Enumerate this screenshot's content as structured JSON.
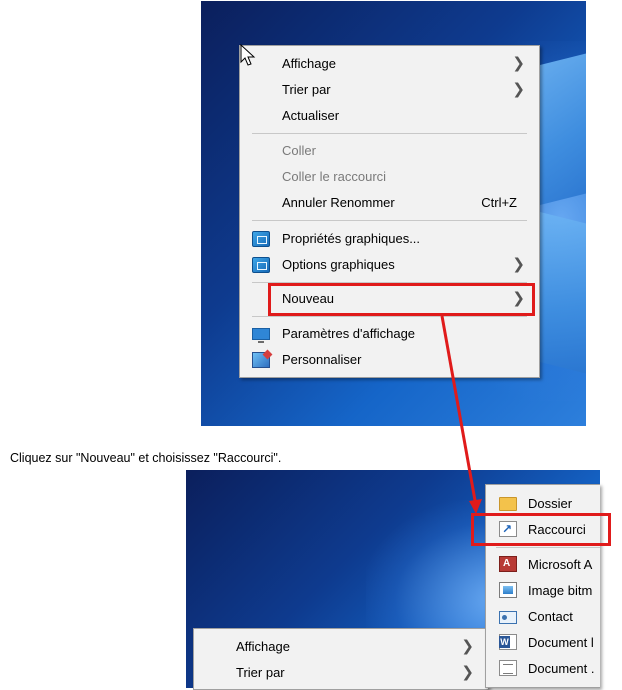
{
  "caption": "Cliquez sur \"Nouveau\" et choisissez \"Raccourci\".",
  "menu1": {
    "items": [
      {
        "label": "Affichage",
        "submenu": true
      },
      {
        "label": "Trier par",
        "submenu": true
      },
      {
        "label": "Actualiser"
      },
      {
        "label": "Coller",
        "disabled": true
      },
      {
        "label": "Coller le raccourci",
        "disabled": true
      },
      {
        "label": "Annuler Renommer",
        "accel": "Ctrl+Z"
      },
      {
        "label": "Propriétés graphiques...",
        "icon": "graphics-properties-icon"
      },
      {
        "label": "Options graphiques",
        "icon": "graphics-options-icon",
        "submenu": true
      },
      {
        "label": "Nouveau",
        "submenu": true,
        "highlighted": true
      },
      {
        "label": "Paramètres d'affichage",
        "icon": "display-settings-icon"
      },
      {
        "label": "Personnaliser",
        "icon": "personalize-icon"
      }
    ]
  },
  "menu2": {
    "items": [
      {
        "label": "Affichage",
        "submenu": true
      },
      {
        "label": "Trier par",
        "submenu": true
      }
    ]
  },
  "submenu_new": {
    "items": [
      {
        "label": "Dossier",
        "icon": "folder-icon"
      },
      {
        "label": "Raccourci",
        "icon": "shortcut-icon",
        "highlighted": true
      },
      {
        "label": "Microsoft A",
        "icon": "access-icon"
      },
      {
        "label": "Image bitm",
        "icon": "bitmap-image-icon"
      },
      {
        "label": "Contact",
        "icon": "contact-icon"
      },
      {
        "label": "Document l",
        "icon": "word-document-icon"
      },
      {
        "label": "Document .",
        "icon": "document-icon"
      }
    ]
  },
  "colors": {
    "highlight_red": "#e01b1b",
    "menu_bg": "#f2f2f2",
    "desktop_blue": "#0e3b8f"
  }
}
